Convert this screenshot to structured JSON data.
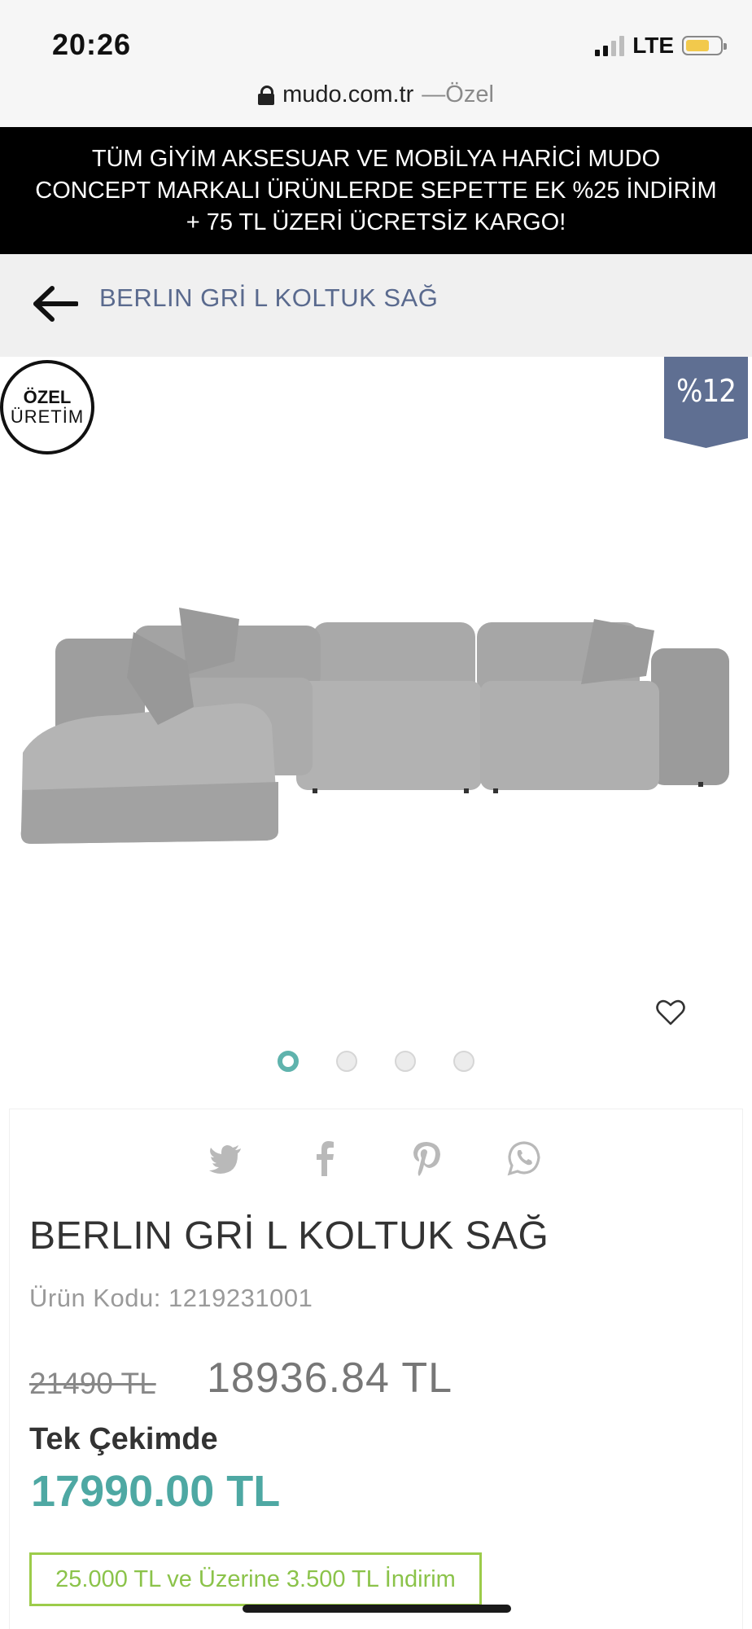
{
  "status_bar": {
    "time": "20:26",
    "network": "LTE",
    "colors": {
      "battery": "#f2c94c"
    }
  },
  "browser": {
    "domain": "mudo.com.tr",
    "separator": " — ",
    "mode": "Özel"
  },
  "promo": {
    "text": "TÜM GİYİM AKSESUAR VE MOBİLYA HARİCİ MUDO CONCEPT MARKALI ÜRÜNLERDE SEPETTE EK %25 İNDİRİM + 75 TL ÜZERİ ÜCRETSİZ KARGO!"
  },
  "header": {
    "back_icon": "arrow-left-icon",
    "title": "BERLIN GRİ L KOLTUK SAĞ"
  },
  "gallery": {
    "badge_line1": "ÖZEL",
    "badge_line2": "ÜRETİM",
    "discount": "%12",
    "favorite_icon": "heart-icon",
    "slide_count": 4,
    "active_slide": 1,
    "colors": {
      "discount_bg": "#5f6f92",
      "active_dot": "#5fb3ad"
    }
  },
  "share": {
    "icons": [
      "twitter-icon",
      "facebook-icon",
      "pinterest-icon",
      "whatsapp-icon"
    ]
  },
  "product": {
    "title": "BERLIN GRİ L KOLTUK SAĞ",
    "code_label": "Ürün Kodu:",
    "code": "1219231001",
    "old_price": "21490 TL",
    "new_price": "18936.84 TL",
    "single_payment_label": "Tek Çekimde",
    "single_payment_price": "17990.00 TL",
    "campaign": "25.000 TL ve Üzerine 3.500 TL İndirim",
    "colors": {
      "single_price": "#4ea8a3",
      "campaign": "#8bc34a",
      "title_link": "#5a6a8e"
    }
  }
}
